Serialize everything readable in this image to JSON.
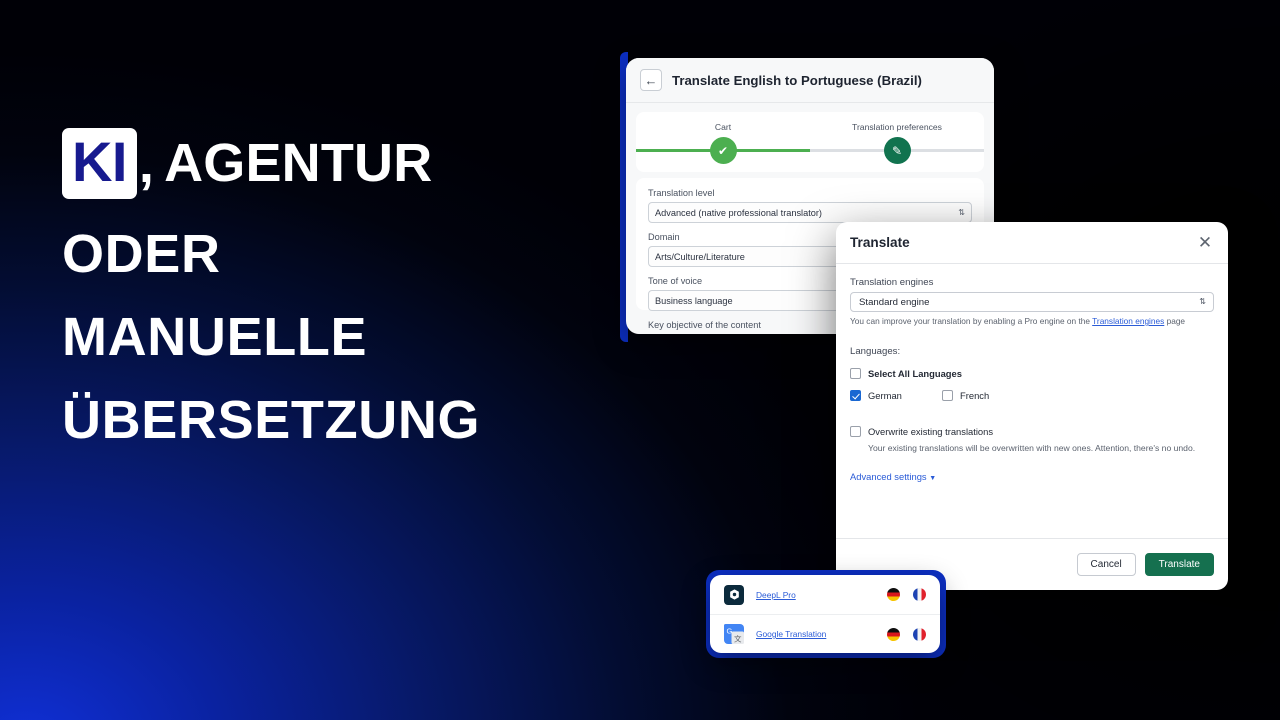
{
  "brand": {
    "badge_text": "KI",
    "comma": ",",
    "line1_rest": "Agentur",
    "line2": "oder",
    "line3": "manuelle",
    "line4": "Übersetzung",
    "badge_bg": "#ffffff",
    "badge_fg": "#171a8f",
    "bg_blue": "#0c2fc4",
    "bg_dark": "#01030e"
  },
  "preferences_card": {
    "back_icon": "arrow-left-icon",
    "title": "Translate English to Portuguese (Brazil)",
    "steps": [
      {
        "label": "Cart",
        "icon": "check-icon",
        "state": "done",
        "color": "#4caf50"
      },
      {
        "label": "Translation preferences",
        "icon": "pencil-icon",
        "state": "current",
        "color": "#11734f"
      }
    ],
    "fields": [
      {
        "label": "Translation level",
        "value": "Advanced (native professional translator)"
      },
      {
        "label": "Domain",
        "value": "Arts/Culture/Literature"
      },
      {
        "label": "Tone of voice",
        "value": "Business language"
      },
      {
        "label": "Key objective of the content",
        "value": ""
      }
    ]
  },
  "modal": {
    "title": "Translate",
    "close_icon": "close-icon",
    "engines_label": "Translation engines",
    "engine_selected": "Standard engine",
    "engine_caret": "⇅",
    "hint_prefix": "You can improve your translation by enabling a Pro engine on the ",
    "hint_link": "Translation engines",
    "hint_suffix": " page",
    "languages_label": "Languages:",
    "select_all": {
      "label": "Select All Languages",
      "checked": false
    },
    "languages": [
      {
        "label": "German",
        "checked": true
      },
      {
        "label": "French",
        "checked": false
      }
    ],
    "overwrite": {
      "label": "Overwrite existing translations",
      "checked": false
    },
    "overwrite_desc": "Your existing translations will be overwritten with new ones. Attention, there's no undo.",
    "advanced_settings": "Advanced settings",
    "advanced_caret": "▼",
    "buttons": {
      "cancel": "Cancel",
      "translate": "Translate",
      "translate_color": "#15704f"
    }
  },
  "engines_card": {
    "rows": [
      {
        "icon": "deepl-icon",
        "name": "DeepL Pro",
        "flags": [
          "flag-germany-icon",
          "flag-france-icon"
        ]
      },
      {
        "icon": "google-translate-icon",
        "name": "Google Translation",
        "flags": [
          "flag-germany-icon",
          "flag-france-icon"
        ]
      }
    ]
  }
}
